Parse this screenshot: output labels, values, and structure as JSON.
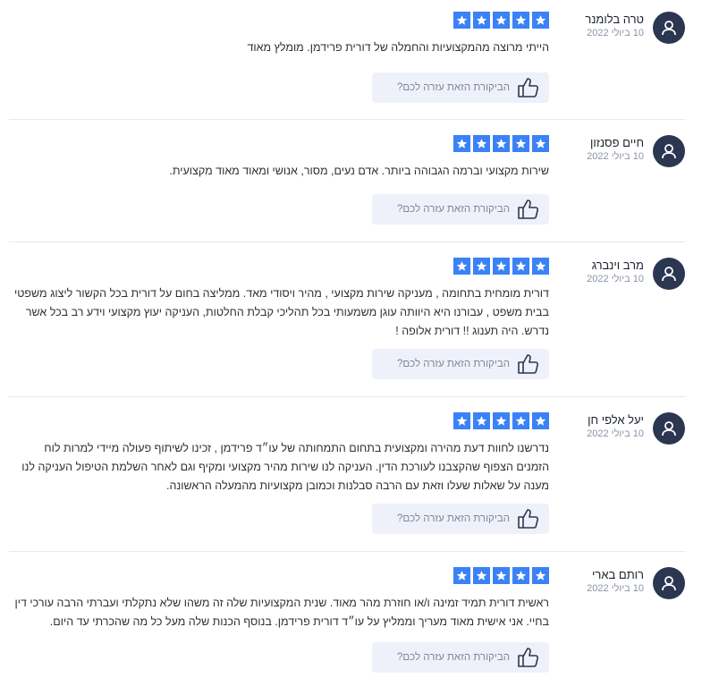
{
  "reviews": [
    {
      "name": "טרה בלומנר",
      "date": "10 ביולי 2022",
      "rating": 5,
      "text": "הייתי מרוצה מהמקצועיות והחמלה של דורית פרידמן. מומלץ מאוד",
      "helpful_label": "הביקורת הזאת עזרה לכם?"
    },
    {
      "name": "חיים פסנזון",
      "date": "10 ביולי 2022",
      "rating": 5,
      "text": "שירות מקצועי וברמה הגבוהה ביותר. אדם נעים, מסור, אנושי ומאוד מאוד מקצועית.",
      "helpful_label": "הביקורת הזאת עזרה לכם?"
    },
    {
      "name": "מרב וינברג",
      "date": "10 ביולי 2022",
      "rating": 5,
      "text": "דורית מומחית בתחומה , מעניקה שירות מקצועי , מהיר ויסודי מאד. ממליצה בחום על דורית בכל הקשור ליצוג משפטי בבית משפט , עבורנו היא היוותה עוגן משמעותי בכל תהליכי קבלת החלטות, העניקה יעוץ מקצועי וידע רב בכל אשר נדרש. היה תענוג !! דורית אלופה !",
      "helpful_label": "הביקורת הזאת עזרה לכם?"
    },
    {
      "name": "יעל אלפי חן",
      "date": "10 ביולי 2022",
      "rating": 5,
      "text": "נדרשנו לחוות דעת מהירה ומקצועית בתחום התמחותה של עו״ד פרידמן , זכינו לשיתוף פעולה מיידי למרות לוח הזמנים הצפוף שהקצבנו לעורכת הדין. העניקה לנו שירות מהיר מקצועי ומקיף וגם לאחר השלמת הטיפול העניקה לנו מענה על שאלות שעלו וזאת עם הרבה סבלנות וכמובן מקצועיות מהמעלה הראשונה.",
      "helpful_label": "הביקורת הזאת עזרה לכם?"
    },
    {
      "name": "רותם בארי",
      "date": "10 ביולי 2022",
      "rating": 5,
      "text": "ראשית דורית תמיד זמינה ו/או חוזרת מהר מאוד. שנית המקצועיות שלה זה משהו שלא נתקלתי ועברתי הרבה עורכי דין בחיי. אני אישית מאוד מעריך וממליץ על עו״ד דורית פרידמן. בנוסף הכנות שלה מעל כל מה שהכרתי עד היום.",
      "helpful_label": "הביקורת הזאת עזרה לכם?"
    }
  ],
  "colors": {
    "star": "#3b82f6",
    "avatar": "#2b3651",
    "helpful_bg": "#eef1fa"
  },
  "icons": {
    "avatar": "user-icon",
    "star": "star-icon",
    "helpful": "thumbs-up-icon"
  }
}
